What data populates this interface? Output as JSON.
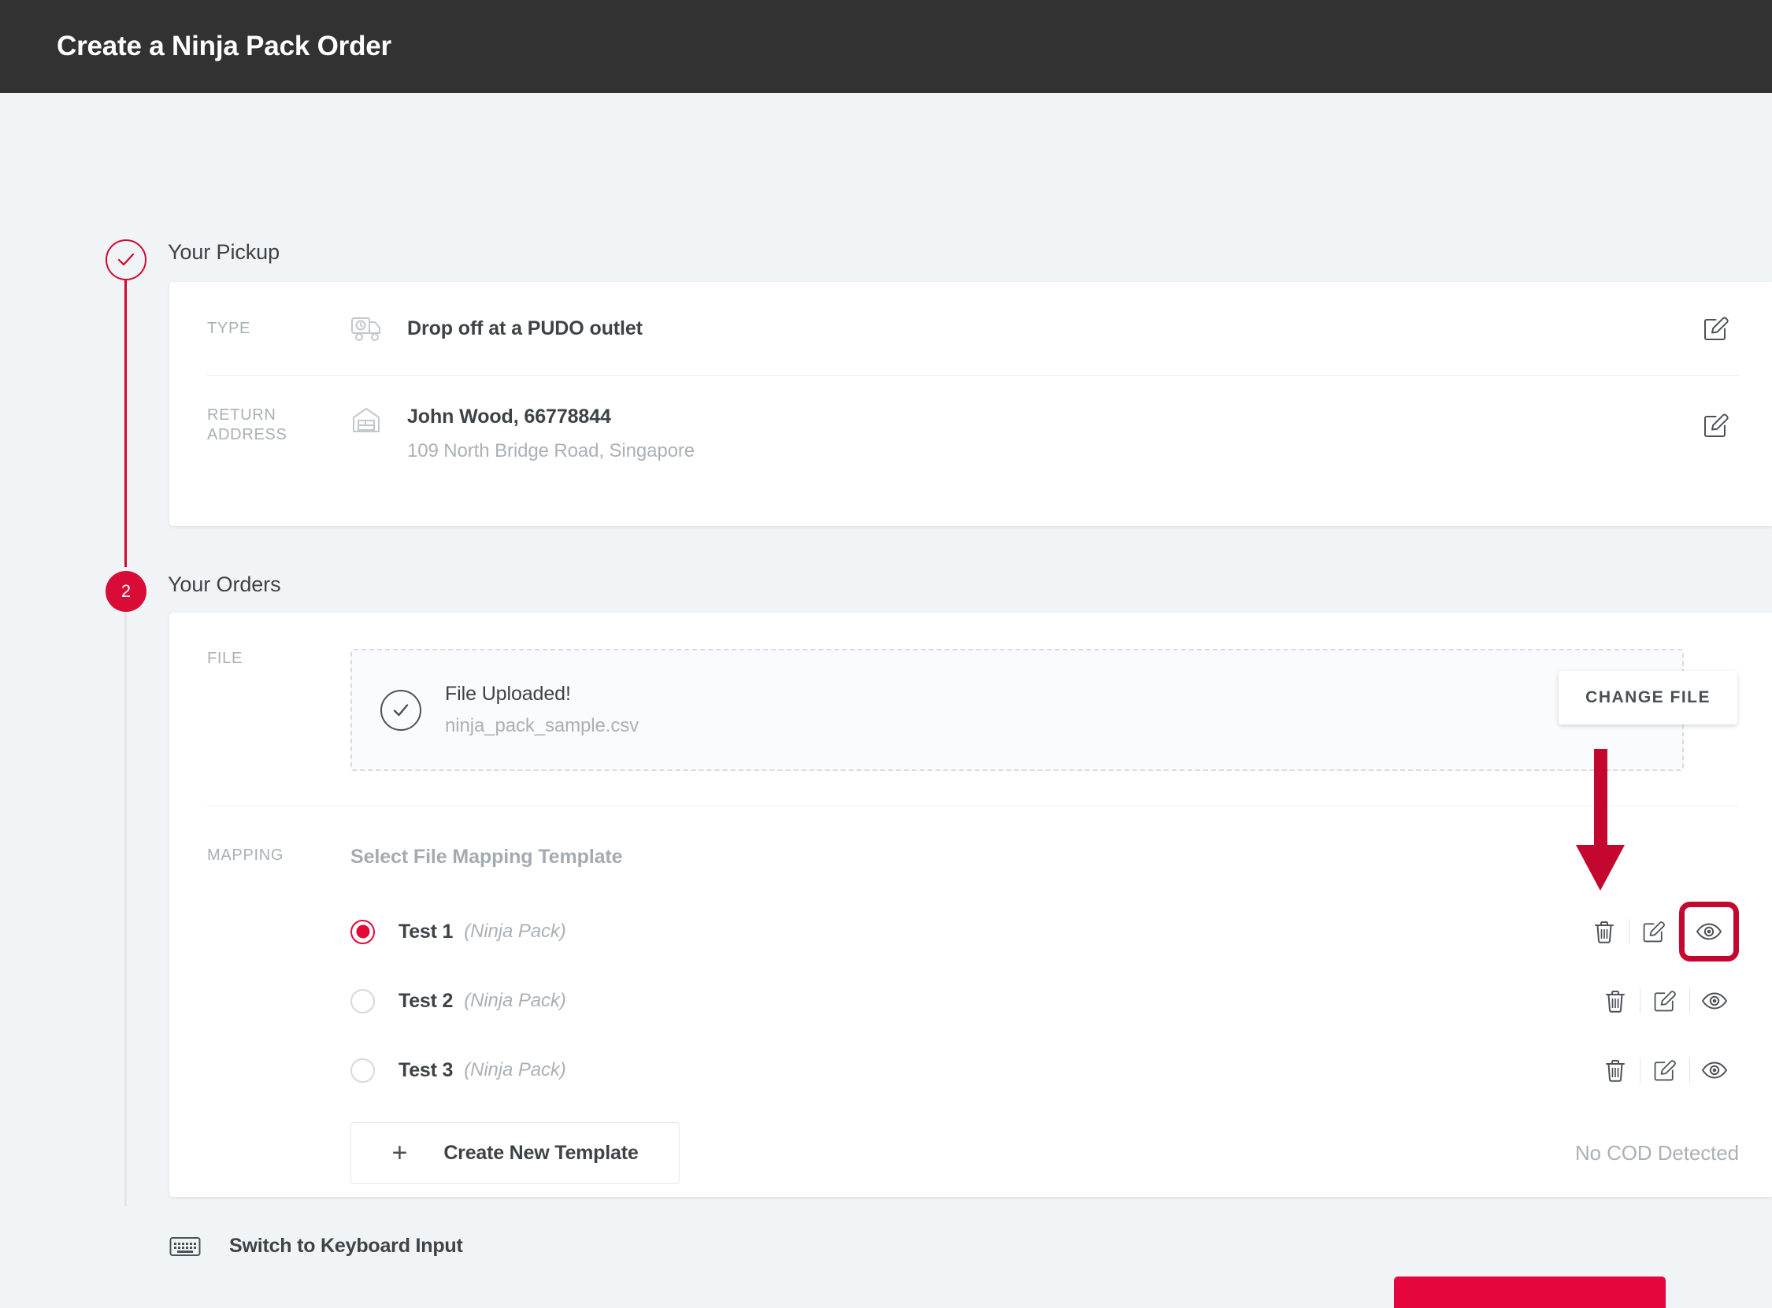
{
  "header": {
    "title": "Create a Ninja Pack Order"
  },
  "steps": {
    "step1": {
      "label": "Your Pickup",
      "state": "done",
      "marker_icon": "check-icon"
    },
    "step2": {
      "label": "Your Orders",
      "state": "active",
      "marker": "2"
    }
  },
  "pickup": {
    "type": {
      "label": "TYPE",
      "icon": "delivery-truck-icon",
      "value": "Drop off at a PUDO outlet",
      "edit_icon": "edit-pencil-square-icon"
    },
    "return_address": {
      "label": "RETURN ADDRESS",
      "icon": "warehouse-icon",
      "value": "John Wood, 66778844",
      "detail": "109 North Bridge Road, Singapore",
      "edit_icon": "edit-pencil-square-icon"
    }
  },
  "orders": {
    "file": {
      "label": "FILE",
      "status_icon": "check-circle-icon",
      "status": "File Uploaded!",
      "filename": "ninja_pack_sample.csv",
      "change_button": "CHANGE FILE"
    },
    "mapping": {
      "label": "MAPPING",
      "heading": "Select File Mapping Template",
      "templates": [
        {
          "name": "Test 1",
          "kind": "(Ninja Pack)",
          "selected": true,
          "highlighted_action": "preview-eye-icon"
        },
        {
          "name": "Test 2",
          "kind": "(Ninja Pack)",
          "selected": false,
          "highlighted_action": null
        },
        {
          "name": "Test 3",
          "kind": "(Ninja Pack)",
          "selected": false,
          "highlighted_action": null
        }
      ],
      "actions": [
        "delete-trash-icon",
        "edit-pencil-square-icon",
        "preview-eye-icon"
      ],
      "create_button": {
        "icon": "plus-icon",
        "label": "Create New Template"
      },
      "cod_status": "No COD Detected"
    }
  },
  "footer": {
    "keyboard_switch": {
      "icon": "keyboard-icon",
      "label": "Switch to Keyboard Input"
    }
  },
  "annotation": {
    "arrow_color": "#c4072f",
    "highlight_color": "#c4072f",
    "points_to": "preview-eye-icon"
  },
  "colors": {
    "header_bg": "#323232",
    "page_bg": "#f0f4f7",
    "brand_crimson": "#d90c38",
    "accent_red": "#e4063c",
    "text_dark": "#3d4347",
    "text_muted": "#a9b1b7"
  }
}
